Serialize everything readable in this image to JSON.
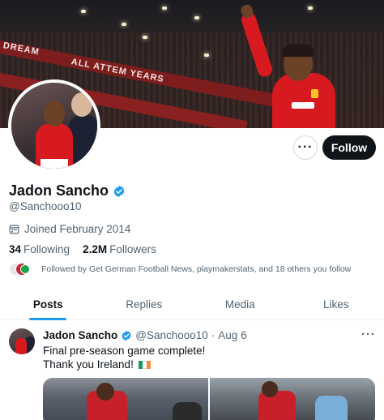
{
  "banner": {
    "signage_1": "DREAM",
    "signage_2": "ALL ATTEM YEARS"
  },
  "profile": {
    "name": "Jadon Sancho",
    "handle": "@Sanchooo10",
    "joined": "Joined February 2014",
    "following_count": "34",
    "following_label": "Following",
    "followers_count": "2.2M",
    "followers_label": "Followers",
    "followed_by": "Followed by Get German Football News, playmakerstats, and 18 others you follow"
  },
  "actions": {
    "more_label": "···",
    "follow_label": "Follow"
  },
  "tabs": [
    {
      "label": "Posts",
      "active": true
    },
    {
      "label": "Replies",
      "active": false
    },
    {
      "label": "Media",
      "active": false
    },
    {
      "label": "Likes",
      "active": false
    }
  ],
  "post": {
    "author": "Jadon Sancho",
    "handle": "@Sanchooo10",
    "separator": "·",
    "date": "Aug 6",
    "more_label": "···",
    "line1": "Final pre-season game complete!",
    "line2": "Thank you Ireland!"
  },
  "colors": {
    "accent": "#1d9bf0",
    "verified": "#1d9bf0",
    "follow_bg": "#0f1419",
    "text_secondary": "#536471",
    "kit_red": "#d71920",
    "flag": [
      "#169b62",
      "#ffffff",
      "#ff883e"
    ]
  },
  "icons": {
    "verified": "verified-badge-icon",
    "calendar": "calendar-icon",
    "more": "more-horizontal-icon",
    "flag": "ireland-flag-icon"
  }
}
